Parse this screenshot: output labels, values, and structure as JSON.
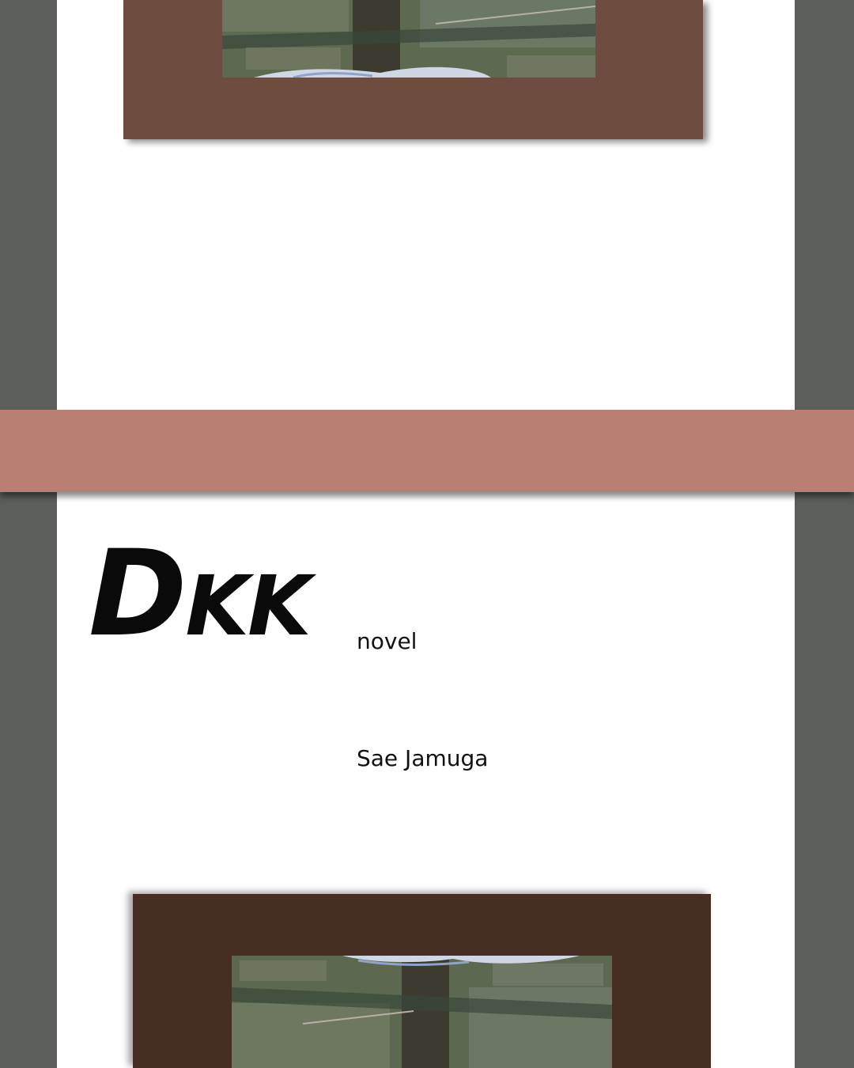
{
  "cover": {
    "title_first": "D",
    "title_rest": "KK",
    "subtitle": "novel",
    "author": "Sae Jamuga"
  },
  "colors": {
    "background": "#5b5e5b",
    "page": "#ffffff",
    "band": "#b97f73",
    "frame_top": "#6e4c40",
    "frame_bottom": "#462e25"
  }
}
